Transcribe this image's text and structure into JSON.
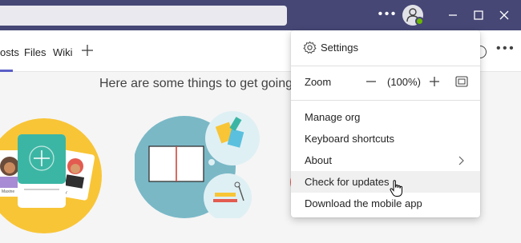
{
  "titlebar": {
    "more_icon": "more-horizontal-icon",
    "avatar_icon": "person-icon",
    "status_color": "#6bb700",
    "accent_color": "#464775",
    "window_controls": [
      "minimize-icon",
      "maximize-icon",
      "close-icon"
    ]
  },
  "tabs": {
    "items": [
      {
        "label": "osts",
        "active": true
      },
      {
        "label": "Files",
        "active": false
      },
      {
        "label": "Wiki",
        "active": false
      }
    ],
    "add_icon": "plus-icon",
    "active_color": "#5b5fc7"
  },
  "content": {
    "heading": "Here are some things to get going..."
  },
  "menu": {
    "settings": {
      "label": "Settings",
      "icon": "gear-icon"
    },
    "zoom": {
      "label": "Zoom",
      "value": "(100%)",
      "minus_icon": "minus-icon",
      "plus_icon": "plus-icon",
      "fit_icon": "fit-to-screen-icon"
    },
    "items": [
      {
        "label": "Manage org"
      },
      {
        "label": "Keyboard shortcuts"
      },
      {
        "label": "About",
        "icon": "chevron-right-icon"
      },
      {
        "label": "Check for updates",
        "hovered": true
      },
      {
        "label": "Download the mobile app"
      }
    ]
  },
  "illustrations": {
    "card_names": [
      "Maxine",
      "ly"
    ]
  }
}
